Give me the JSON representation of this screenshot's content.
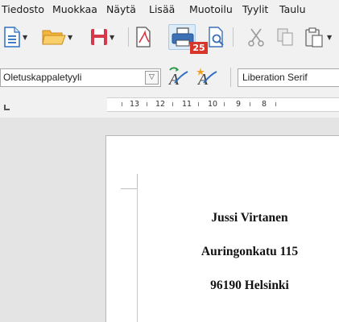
{
  "menubar": {
    "items": [
      {
        "label": "Tiedosto"
      },
      {
        "label": "Muokkaa"
      },
      {
        "label": "Näytä"
      },
      {
        "label": "Lisää"
      },
      {
        "label": "Muotoilu"
      },
      {
        "label": "Tyylit"
      },
      {
        "label": "Taulu"
      }
    ]
  },
  "toolbar": {
    "icons": [
      "new-document-icon",
      "open-folder-icon",
      "save-icon",
      "export-pdf-icon",
      "print-icon",
      "print-preview-icon",
      "cut-icon",
      "copy-icon",
      "paste-icon"
    ],
    "print_badge": "25",
    "accent_color": "#2f6fbf",
    "badge_color": "#d9362b"
  },
  "formatting": {
    "paragraph_style": "Oletuskappaletyyli",
    "font_name": "Liberation Serif",
    "icons": [
      "update-style-icon",
      "new-style-icon"
    ]
  },
  "ruler": {
    "numbers": [
      "13",
      "12",
      "11",
      "10",
      "9",
      "8"
    ]
  },
  "document": {
    "lines": [
      "Jussi Virtanen",
      "Auringonkatu 115",
      "96190 Helsinki"
    ]
  }
}
